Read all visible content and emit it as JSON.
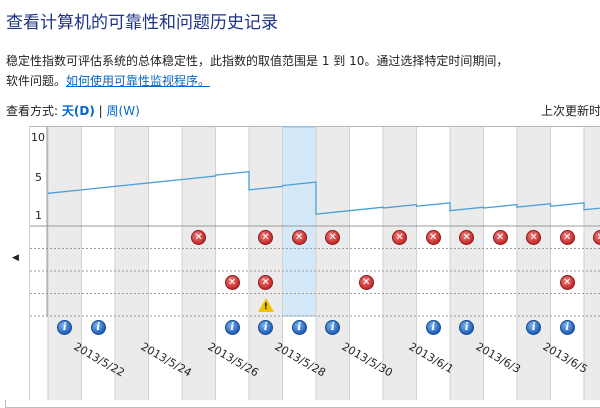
{
  "title": "查看计算机的可靠性和问题历史记录",
  "description_line1": "稳定性指数可评估系统的总体稳定性，此指数的取值范围是 1 到 10。通过选择特定时间期间，",
  "description_line2_prefix": "软件问题。",
  "help_link": "如何使用可靠性监视程序。",
  "view_by_label": "查看方式:",
  "view_day": "天(D)",
  "view_separator": "|",
  "view_week": "周(W)",
  "last_updated": "上次更新时",
  "y_ticks": [
    "10",
    "5",
    "1"
  ],
  "dates": [
    "2013/5/22",
    "2013/5/24",
    "2013/5/26",
    "2013/5/28",
    "2013/5/30",
    "2013/6/1",
    "2013/6/3",
    "2013/6/5"
  ],
  "selected_column": 7,
  "columns": 17,
  "icons": {
    "failure": "x-error-icon",
    "warning": "warning-triangle-icon",
    "info": "info-icon",
    "scroll_left": "left-arrow-icon"
  },
  "colors": {
    "title": "#1e3287",
    "link": "#0066cc",
    "stability_line": "#4a9fd8",
    "selected_column": "#d4e8f8",
    "failure": "#c62a2a",
    "info": "#1f5fb8",
    "warning": "#f2c200"
  },
  "chart_data": {
    "type": "line",
    "y_ticks": [
      10,
      5,
      1
    ],
    "ylim": [
      1,
      10
    ],
    "series": [
      {
        "values": [
          3.5,
          3.9,
          4.3,
          4.7,
          5.1,
          5.6,
          3.9,
          4.4,
          1.1,
          1.5,
          1.8,
          2.0,
          1.5,
          1.8,
          1.9,
          2.0,
          1.6
        ]
      }
    ],
    "x_labels": [
      "2013/5/22",
      "2013/5/24",
      "2013/5/26",
      "2013/5/28",
      "2013/5/30",
      "2013/6/1",
      "2013/6/3",
      "2013/6/5"
    ],
    "events": {
      "application_failures": [
        5,
        7,
        8,
        9,
        11,
        12,
        13,
        14,
        15,
        16,
        17
      ],
      "windows_failures": [],
      "misc_failures": [
        6,
        7,
        10,
        16
      ],
      "warnings": [
        7
      ],
      "information": [
        0,
        1,
        6,
        7,
        8,
        9,
        12,
        13,
        15,
        16
      ]
    }
  }
}
